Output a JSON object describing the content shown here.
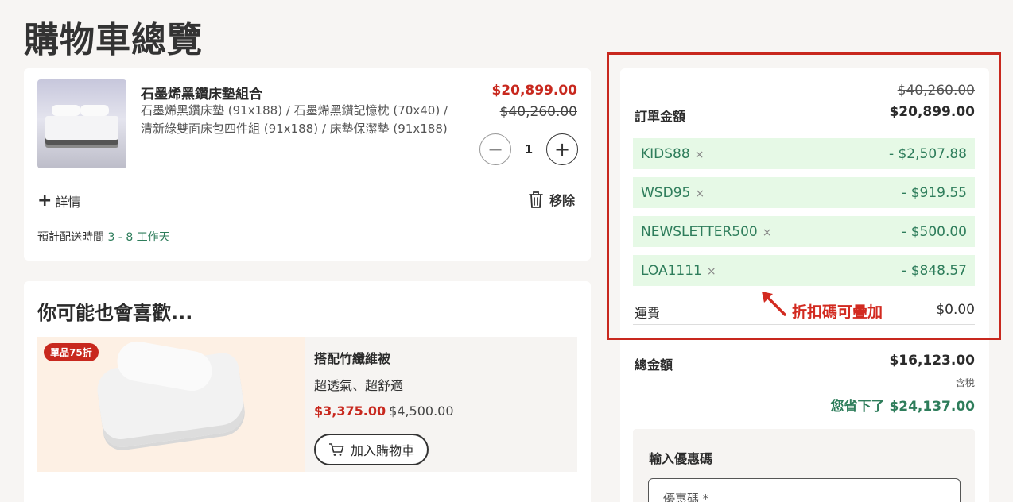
{
  "page": {
    "title": "購物車總覽"
  },
  "cart": {
    "item": {
      "name": "石墨烯黑鑽床墊組合",
      "desc_line1": "石墨烯黑鑽床墊 (91x188) / 石墨烯黑鑽記憶枕 (70x40) /",
      "desc_line2": "清新綠雙面床包四件組 (91x188) / 床墊保潔墊 (91x188)",
      "price_now": "$20,899.00",
      "price_was": "$40,260.00",
      "quantity": "1",
      "minus": "−",
      "plus": "+"
    },
    "details_label": "詳情",
    "remove_label": "移除",
    "delivery_label": "預計配送時間",
    "delivery_days": "3 - 8 工作天"
  },
  "recommend": {
    "title": "你可能也會喜歡...",
    "badge": "單品75折",
    "name": "搭配竹纖維被",
    "subtitle": "超透氣、超舒適",
    "price_now": "$3,375.00",
    "price_was": "$4,500.00",
    "add_label": "加入購物車"
  },
  "summary": {
    "was_total": "$40,260.00",
    "order_label": "訂單金額",
    "order_value": "$20,899.00",
    "coupons": [
      {
        "code": "KIDS88",
        "amount": "- $2,507.88"
      },
      {
        "code": "WSD95",
        "amount": "- $919.55"
      },
      {
        "code": "NEWSLETTER500",
        "amount": "- $500.00"
      },
      {
        "code": "LOA1111",
        "amount": "- $848.57"
      }
    ],
    "remove_symbol": "×",
    "shipping_label": "運費",
    "shipping_value": "$0.00",
    "total_label": "總金額",
    "total_value": "$16,123.00",
    "tax_note": "含稅",
    "saved": "您省下了 $24,137.00",
    "promo_title": "輸入優惠碼",
    "promo_placeholder": "優惠碼 *"
  },
  "annotation": {
    "text": "折扣碼可疊加"
  },
  "colors": {
    "accent_red": "#c8281e",
    "discount_green": "#2e7d5b",
    "coupon_bg": "#e6f9e6"
  }
}
